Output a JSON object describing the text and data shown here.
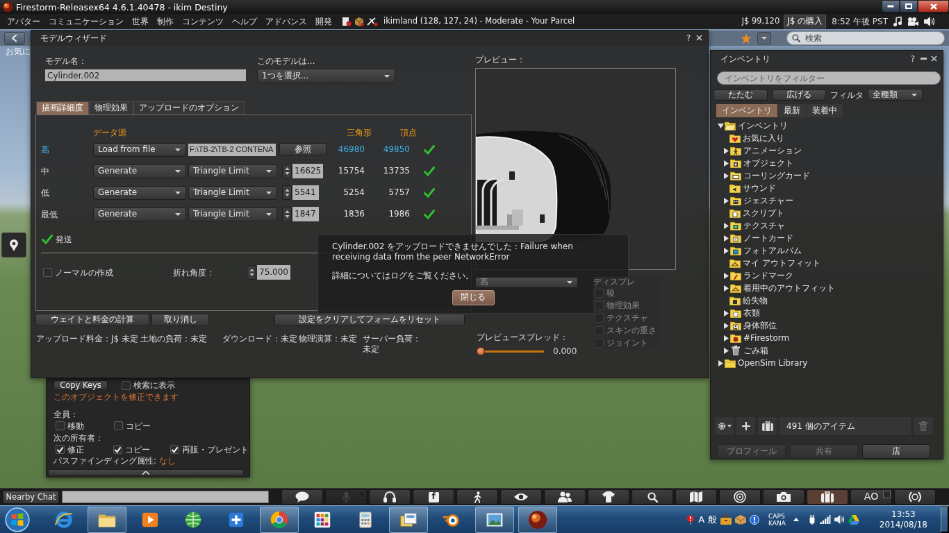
{
  "window": {
    "title": "Firestorm-Releasex64 4.6.1.40478 - ikim Destiny"
  },
  "menu_bar": {
    "menus": [
      "アバター",
      "コミュニケーション",
      "世界",
      "制作",
      "コンテンツ",
      "ヘルプ",
      "アドバンス",
      "開発"
    ],
    "location": "ikimland (128, 127, 24) - Moderate - Your Parcel",
    "balance": "J$ 99,120",
    "buy": "J$ の購入",
    "clock": "8:52 午後 PST"
  },
  "navigation": {
    "favorites": "お気に",
    "search": {
      "placeholder": "検索"
    }
  },
  "model_wizard": {
    "title": "モデルウィザード",
    "help": "?",
    "name_label": "モデル名：",
    "name": "Cylinder.002",
    "type_label": "このモデルは...",
    "type": "1つを選択...",
    "tabs": [
      {
        "label": "描画詳細度",
        "selected": true
      },
      {
        "label": "物理効果",
        "selected": false
      },
      {
        "label": "アップロードのオプション",
        "selected": false
      }
    ],
    "lod": {
      "source_header": "データ源",
      "triangles_header": "三角形",
      "vertices_header": "頂点",
      "rows": [
        {
          "level": "高",
          "kind": "file",
          "selected": true,
          "source": "Load from file",
          "file": "F:\\TB-2\\TB-2 CONTENA",
          "browse": "参照",
          "triangles": "46980",
          "vertices": "49850",
          "ok": true
        },
        {
          "level": "中",
          "kind": "generate",
          "selected": false,
          "source": "Generate",
          "method": "Triangle Limit",
          "limit": "16625",
          "triangles": "15754",
          "vertices": "13735",
          "ok": true
        },
        {
          "level": "低",
          "kind": "generate",
          "selected": false,
          "source": "Generate",
          "method": "Triangle Limit",
          "limit": "5541",
          "triangles": "5254",
          "vertices": "5757",
          "ok": true
        },
        {
          "level": "最低",
          "kind": "generate",
          "selected": false,
          "source": "Generate",
          "method": "Triangle Limit",
          "limit": "1847",
          "triangles": "1836",
          "vertices": "1986",
          "ok": true
        }
      ]
    },
    "status": {
      "ok": true,
      "text": "発送"
    },
    "normals": {
      "label": "ノーマルの作成",
      "checked": false
    },
    "crease": {
      "label": "折れ角度：",
      "value": "75.000"
    },
    "buttons": [
      "ウェイトと料金の計算",
      "取り消し",
      "設定をクリアしてフォームをリセット"
    ],
    "costs": [
      "アップロード料金：J$ 未定",
      "土地の負荷：未定",
      "ダウンロード：未定",
      "物理演算：未定",
      "サーバー負荷：未定"
    ],
    "preview": {
      "label": "プレビュー：",
      "lod": {
        "value": "高",
        "disabled": true
      },
      "display_label": "ディスプレ",
      "display_options": [
        {
          "label": "稜",
          "checked": false,
          "disabled": true
        },
        {
          "label": "物理効果",
          "checked": false,
          "disabled": true
        },
        {
          "label": "テクスチャ",
          "checked": false,
          "disabled": true
        },
        {
          "label": "スキンの重さ",
          "checked": false,
          "disabled": true
        },
        {
          "label": "ジョイント",
          "checked": false,
          "disabled": true
        }
      ],
      "spread_label": "プレビュースプレッド：",
      "spread": {
        "level": 0,
        "reading": "0.000"
      }
    }
  },
  "error_dialog": {
    "message": "Cylinder.002 をアップロードできませんでした：Failure when receiving data from the peer NetworkError",
    "detail": "詳細についてはログをご覧ください。",
    "button": "閉じる"
  },
  "build_floater": {
    "copy_keys": "Copy Keys",
    "show_in_search": {
      "label": "検索に表示",
      "checked": false
    },
    "modify_note": "このオブジェクトを修正できます",
    "everyone_label": "全員：",
    "everyone": [
      {
        "label": "移動",
        "checked": false
      },
      {
        "label": "コピー",
        "checked": false
      }
    ],
    "next_owner_label": "次の所有者：",
    "next_owner": [
      {
        "label": "修正",
        "checked": true
      },
      {
        "label": "コピー",
        "checked": true
      },
      {
        "label": "再販・プレゼント",
        "checked": true
      }
    ],
    "pathfinding_label": "パスファインディング属性:",
    "pathfinding_value": "なし"
  },
  "inventory": {
    "title": "インベントリ",
    "help": "?",
    "filter": {
      "placeholder": "インベントリをフィルター"
    },
    "buttons": [
      "たたむ",
      "広げる"
    ],
    "filter_label": "フィルタ",
    "filter_type": "全種類",
    "tabs": [
      {
        "label": "インベントリ",
        "selected": true
      },
      {
        "label": "最新",
        "selected": false
      },
      {
        "label": "装着中",
        "selected": false
      }
    ],
    "tree": [
      {
        "label": "インベントリ",
        "kind": "root",
        "expandable": true,
        "expanded": true,
        "children": [
          {
            "label": "お気に入り",
            "kind": "favorites",
            "expandable": false,
            "expanded": false
          },
          {
            "label": "アニメーション",
            "kind": "animation",
            "expandable": true,
            "expanded": false
          },
          {
            "label": "オブジェクト",
            "kind": "object",
            "expandable": true,
            "expanded": false
          },
          {
            "label": "コーリングカード",
            "kind": "callingcard",
            "expandable": true,
            "expanded": false
          },
          {
            "label": "サウンド",
            "kind": "sound",
            "expandable": false,
            "expanded": false
          },
          {
            "label": "ジェスチャー",
            "kind": "gesture",
            "expandable": true,
            "expanded": false
          },
          {
            "label": "スクリプト",
            "kind": "script",
            "expandable": false,
            "expanded": false
          },
          {
            "label": "テクスチャ",
            "kind": "texture",
            "expandable": true,
            "expanded": false
          },
          {
            "label": "ノートカード",
            "kind": "notecard",
            "expandable": true,
            "expanded": false
          },
          {
            "label": "フォトアルバム",
            "kind": "photo",
            "expandable": true,
            "expanded": false
          },
          {
            "label": "マイ アウトフィット",
            "kind": "outfit",
            "expandable": false,
            "expanded": false
          },
          {
            "label": "ランドマーク",
            "kind": "landmark",
            "expandable": true,
            "expanded": false
          },
          {
            "label": "着用中のアウトフィット",
            "kind": "outfit",
            "expandable": true,
            "expanded": false
          },
          {
            "label": "紛失物",
            "kind": "lost",
            "expandable": false,
            "expanded": false
          },
          {
            "label": "衣類",
            "kind": "clothing",
            "expandable": true,
            "expanded": false
          },
          {
            "label": "身体部位",
            "kind": "bodypart",
            "expandable": true,
            "expanded": false
          },
          {
            "label": "#Firestorm",
            "kind": "custom",
            "expandable": true,
            "expanded": false
          },
          {
            "label": "ごみ箱",
            "kind": "trash",
            "expandable": true,
            "expanded": false
          }
        ]
      },
      {
        "label": "OpenSim Library",
        "kind": "library",
        "expandable": true,
        "expanded": false
      }
    ],
    "item_count": "491 個のアイテム",
    "bottom_buttons": [
      {
        "label": "プロフィール",
        "disabled": true
      },
      {
        "label": "共有",
        "disabled": true
      },
      {
        "label": "店",
        "disabled": false
      }
    ]
  },
  "chat_bar": {
    "button": "Nearby Chat"
  },
  "toolbar": [
    {
      "kind": "chat",
      "selected": false,
      "disabled": false,
      "toggle": false
    },
    {
      "kind": "voice",
      "selected": false,
      "disabled": true,
      "toggle": true
    },
    {
      "kind": "headphones",
      "selected": false,
      "disabled": false,
      "toggle": false
    },
    {
      "kind": "social",
      "label": "f",
      "selected": false,
      "disabled": false,
      "toggle": false
    },
    {
      "kind": "walk",
      "selected": false,
      "disabled": false,
      "toggle": false
    },
    {
      "kind": "eye",
      "selected": false,
      "disabled": false,
      "toggle": false
    },
    {
      "kind": "people",
      "selected": false,
      "disabled": false,
      "toggle": false
    },
    {
      "kind": "shirt",
      "selected": false,
      "disabled": false,
      "toggle": false
    },
    {
      "kind": "search",
      "selected": false,
      "disabled": false,
      "toggle": false
    },
    {
      "kind": "map",
      "selected": false,
      "disabled": false,
      "toggle": false
    },
    {
      "kind": "rings",
      "selected": false,
      "disabled": false,
      "toggle": false
    },
    {
      "kind": "camera",
      "selected": false,
      "disabled": false,
      "toggle": false
    },
    {
      "kind": "suitcase",
      "selected": true,
      "disabled": false,
      "toggle": false
    },
    {
      "kind": "ao",
      "label": "AO",
      "selected": false,
      "disabled": false,
      "toggle": true
    },
    {
      "kind": "wreath",
      "selected": false,
      "disabled": false,
      "toggle": false
    }
  ],
  "taskbar": {
    "apps": [
      {
        "kind": "ring",
        "running": false
      },
      {
        "kind": "folder",
        "running": true
      },
      {
        "kind": "play",
        "running": false
      },
      {
        "kind": "globe",
        "running": false
      },
      {
        "kind": "plus",
        "running": false
      },
      {
        "kind": "wheel",
        "running": true
      },
      {
        "kind": "tiles",
        "running": false
      },
      {
        "kind": "calculator",
        "running": false
      },
      {
        "kind": "cards",
        "running": true
      },
      {
        "kind": "orbit",
        "running": false
      },
      {
        "kind": "picture",
        "running": true
      },
      {
        "kind": "orb",
        "running": true
      }
    ],
    "tray": {
      "ime": [
        "A",
        "般"
      ],
      "caps": "CAPS",
      "kana": "KANA",
      "time": "13:53",
      "date": "2014/08/18"
    }
  }
}
